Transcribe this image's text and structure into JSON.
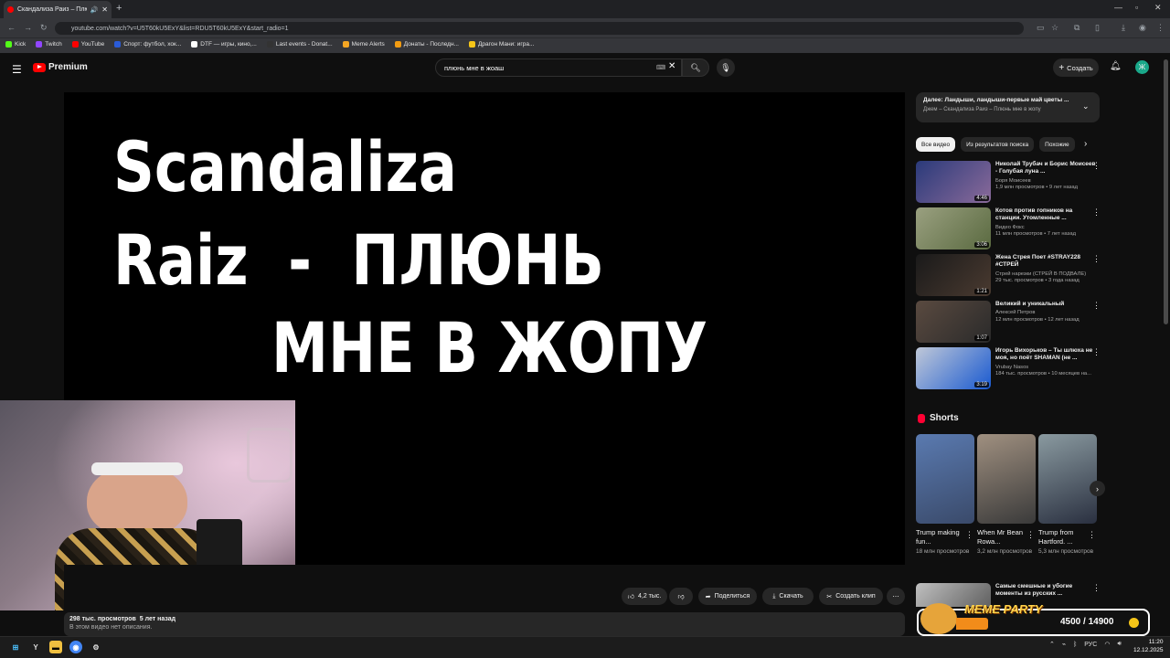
{
  "browser": {
    "tab_title": "Скандализа Раиз – Плюнь",
    "new_tab": "+",
    "url": "youtube.com/watch?v=U5T60kU5ExY&list=RDU5T60kU5ExY&start_radio=1",
    "bookmarks": [
      {
        "label": "Kick",
        "color": "#53fc18"
      },
      {
        "label": "Twitch",
        "color": "#9146ff"
      },
      {
        "label": "YouTube",
        "color": "#ff0000"
      },
      {
        "label": "Спорт: футбол, хок...",
        "color": "#2a5bd7"
      },
      {
        "label": "DTF — игры, кино,...",
        "color": "#ffffff"
      },
      {
        "label": "Last events - Donat...",
        "color": "#333333"
      },
      {
        "label": "Meme Alerts",
        "color": "#f5a623"
      },
      {
        "label": "Донаты - Последн...",
        "color": "#f29c11"
      },
      {
        "label": "Драгон Мани: игра...",
        "color": "#f5c518"
      }
    ]
  },
  "youtube": {
    "logo": "Premium",
    "search_value": "плюнь мне в жоаш",
    "create_label": "Создать",
    "avatar_letter": "Ж"
  },
  "player": {
    "title_line1": "Scandaliza",
    "title_line2": "Raiz  -  ПЛЮНЬ",
    "title_line3": "МНЕ В ЖОПУ",
    "likes": "4,2 тыс.",
    "share": "Поделиться",
    "download": "Скачать",
    "clip": "Создать клип",
    "views_line": "298 тыс. просмотров  5 лет назад",
    "no_description": "В этом видео нет описания."
  },
  "sidebar": {
    "up_next_title": "Далее: Ландыши, ландыши-первые май цветы ...",
    "up_next_sub": "Джем – Скандализа Раиз – Плюнь мне в жопу",
    "chips": [
      "Все видео",
      "Из результатов поиска",
      "Похожие"
    ],
    "videos": [
      {
        "title": "Николай Трубач и Борис Моисеев - Голубая луна ...",
        "channel": "Боря Моисеев",
        "meta": "1,9 млн просмотров • 9 лет назад",
        "duration": "4:46",
        "c1": "#2a3a7a",
        "c2": "#8a6a9a"
      },
      {
        "title": "Котов против гопников на станции. Утомленные ...",
        "channel": "Видео Фокс",
        "meta": "11 млн просмотров • 7 лет назад",
        "duration": "3:06",
        "c1": "#9aa080",
        "c2": "#5a6a40"
      },
      {
        "title": "Жена Стрея Поет #STRAY228 #СТРЕЙ",
        "channel": "Стрей нарезки (СТРЕЙ В ПОДВАЛЕ)",
        "meta": "29 тыс. просмотров • 3 года назад",
        "duration": "1:21",
        "c1": "#1a1a1a",
        "c2": "#4a3a30"
      },
      {
        "title": "Великий и уникальный",
        "channel": "Алексей Петров",
        "meta": "12 млн просмотров • 12 лет назад",
        "duration": "1:07",
        "c1": "#5a4a40",
        "c2": "#2a2a2a"
      },
      {
        "title": "Игорь Вихорьков – Ты шлюха не моя, но поёт SHAMAN (не ...",
        "channel": "Vrubay Nasos",
        "meta": "184 тыс. просмотров • 10 месяцев на...",
        "duration": "3:19",
        "c1": "#c0c8d8",
        "c2": "#1a5ad0"
      }
    ],
    "shorts_heading": "Shorts",
    "shorts": [
      {
        "title": "Trump making fun...",
        "views": "18 млн просмотров",
        "c1": "#5a7ab0",
        "c2": "#3a4a6a"
      },
      {
        "title": "When Mr Bean Rowa...",
        "views": "3,2 млн просмотров",
        "c1": "#a09080",
        "c2": "#3a3a3a"
      },
      {
        "title": "Trump from Hartford. ...",
        "views": "5,3 млн просмотров",
        "c1": "#8a9aa0",
        "c2": "#2a3040"
      }
    ],
    "last_video_title": "Самые смешные и убогие моменты из русских ..."
  },
  "overlay": {
    "label": "MEME PARTY",
    "counter": "4500 / 14900"
  },
  "taskbar": {
    "lang": "РУС",
    "time": "11:20",
    "date": "12.12.2025"
  }
}
